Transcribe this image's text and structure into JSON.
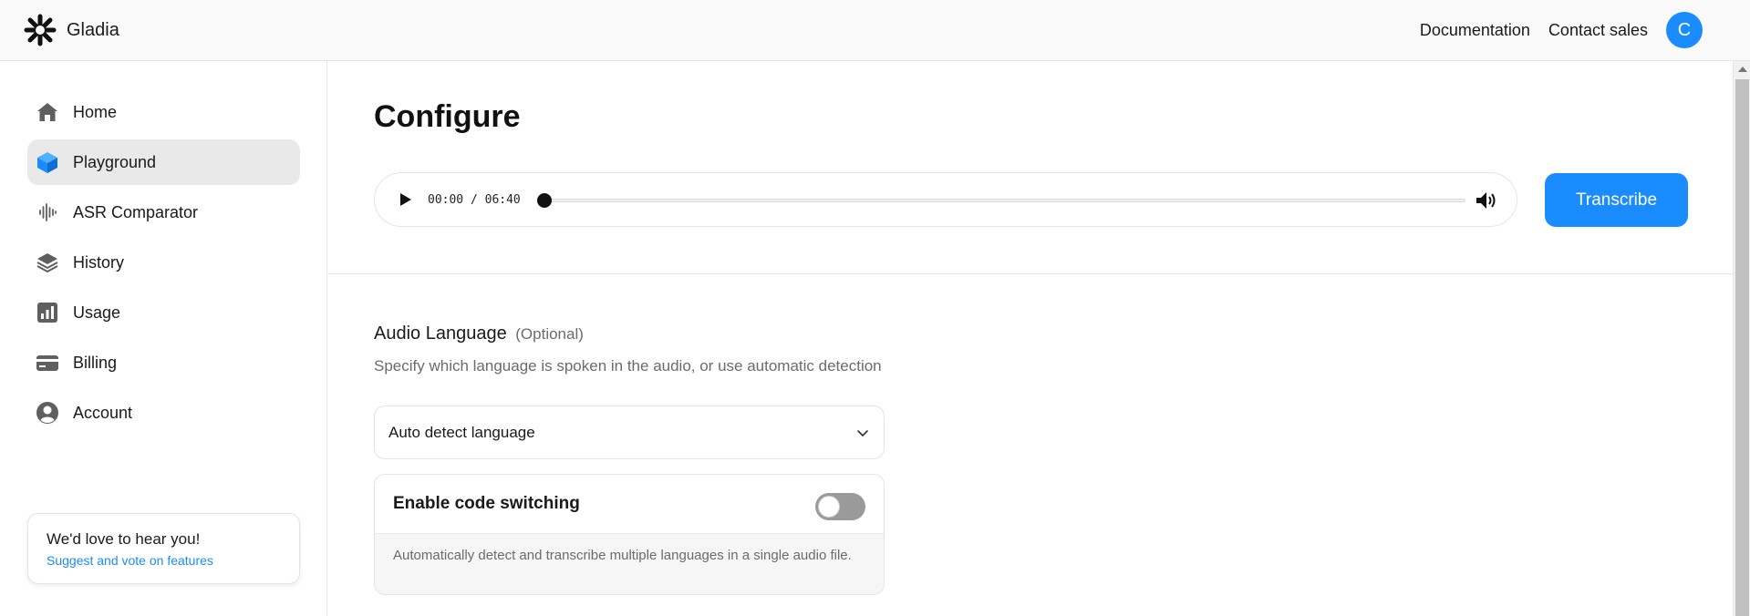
{
  "brand": {
    "name": "Gladia"
  },
  "header": {
    "links": [
      "Documentation",
      "Contact sales"
    ],
    "avatar_initial": "C",
    "accent": "#1a8cff"
  },
  "sidebar": {
    "items": [
      {
        "label": "Home",
        "icon": "home-icon",
        "active": false
      },
      {
        "label": "Playground",
        "icon": "cube-icon",
        "active": true
      },
      {
        "label": "ASR Comparator",
        "icon": "waveform-icon",
        "active": false
      },
      {
        "label": "History",
        "icon": "layers-icon",
        "active": false
      },
      {
        "label": "Usage",
        "icon": "bar-chart-icon",
        "active": false
      },
      {
        "label": "Billing",
        "icon": "credit-card-icon",
        "active": false
      },
      {
        "label": "Account",
        "icon": "user-circle-icon",
        "active": false
      }
    ],
    "feedback": {
      "title": "We'd love to hear you!",
      "link": "Suggest and vote on features"
    }
  },
  "main": {
    "title": "Configure",
    "player": {
      "current_time": "00:00",
      "separator": "/",
      "duration": "06:40",
      "progress": 0
    },
    "transcribe_label": "Transcribe",
    "audio_language": {
      "heading": "Audio Language",
      "optional": "(Optional)",
      "description": "Specify which language is spoken in the audio, or use automatic detection",
      "selected": "Auto detect language"
    },
    "code_switching": {
      "title": "Enable code switching",
      "enabled": false,
      "description": "Automatically detect and transcribe multiple languages in a single audio file."
    }
  }
}
